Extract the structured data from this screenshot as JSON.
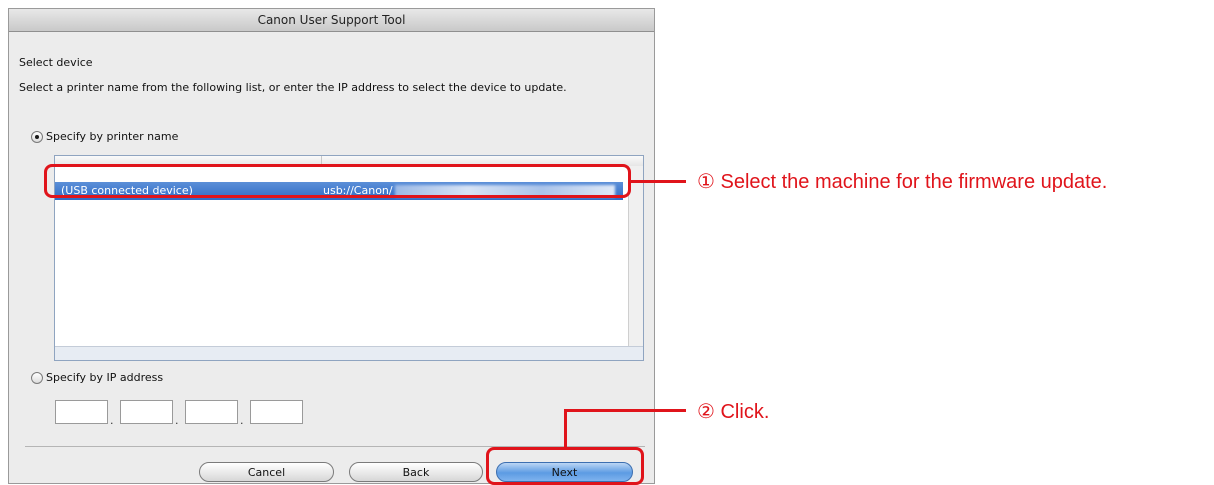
{
  "window": {
    "title": "Canon User Support Tool"
  },
  "dialog": {
    "heading": "Select device",
    "instruction": "Select a printer name from the following list, or enter the IP address to select the device to update.",
    "option_printer_name": "Specify by printer name",
    "option_ip_address": "Specify by IP address",
    "device_list": {
      "rows": [
        {
          "name": "(USB connected device)",
          "port": "usb://Canon/"
        }
      ]
    },
    "ip_fields": [
      "",
      "",
      "",
      ""
    ],
    "buttons": {
      "cancel": "Cancel",
      "back": "Back",
      "next": "Next"
    }
  },
  "annotations": {
    "step1": "① Select the machine for the firmware update.",
    "step2": "② Click."
  },
  "colors": {
    "highlight": "#e0141b",
    "selection": "#3a75cc"
  }
}
